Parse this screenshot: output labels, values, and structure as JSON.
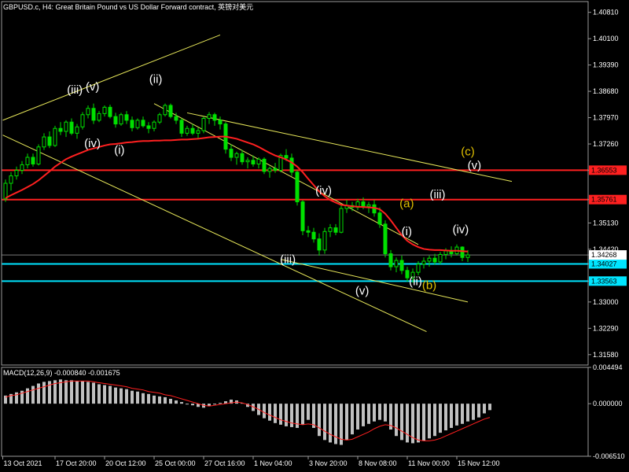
{
  "chart_data": [
    {
      "type": "candlestick",
      "title": "GBPUSD.c, H4:  Great Britain Pound vs US Dollar Forward contract, 英镑对美元",
      "y_ticks": [
        "1.40810",
        "1.40100",
        "1.39390",
        "1.38680",
        "1.37970",
        "1.37260",
        "1.36553",
        "1.35761",
        "1.35130",
        "1.34420",
        "1.34268",
        "1.34027",
        "1.33563",
        "1.33000",
        "1.32290",
        "1.31580"
      ],
      "ylim": [
        1.313,
        1.411
      ],
      "x_ticks": [
        "13 Oct 2021",
        "17 Oct 20:00",
        "20 Oct 12:00",
        "25 Oct 00:00",
        "27 Oct 16:00",
        "1 Nov 04:00",
        "3 Nov 20:00",
        "8 Nov 08:00",
        "11 Nov 00:00",
        "15 Nov 12:00"
      ],
      "horizontal_lines": [
        {
          "value": 1.36553,
          "color": "#ff2020",
          "label": "1.36553"
        },
        {
          "value": 1.35761,
          "color": "#ff2020",
          "label": "1.35761"
        },
        {
          "value": 1.34027,
          "color": "#00e5ff",
          "label": "1.34027"
        },
        {
          "value": 1.33563,
          "color": "#00e5ff",
          "label": "1.33563"
        }
      ],
      "current_price": {
        "value": 1.34268,
        "label": "1.34268"
      },
      "candles": [
        [
          1.3578,
          1.363,
          1.357,
          1.362
        ],
        [
          1.362,
          1.365,
          1.36,
          1.364
        ],
        [
          1.364,
          1.3665,
          1.363,
          1.3655
        ],
        [
          1.3655,
          1.368,
          1.3645,
          1.367
        ],
        [
          1.367,
          1.37,
          1.366,
          1.369
        ],
        [
          1.369,
          1.37,
          1.3665,
          1.3672
        ],
        [
          1.3672,
          1.3725,
          1.3668,
          1.3718
        ],
        [
          1.3718,
          1.3755,
          1.371,
          1.3745
        ],
        [
          1.3745,
          1.376,
          1.3715,
          1.3722
        ],
        [
          1.3722,
          1.3775,
          1.3718,
          1.3768
        ],
        [
          1.3768,
          1.3785,
          1.375,
          1.376
        ],
        [
          1.376,
          1.379,
          1.3745,
          1.3785
        ],
        [
          1.3785,
          1.3795,
          1.375,
          1.3755
        ],
        [
          1.3755,
          1.378,
          1.374,
          1.3772
        ],
        [
          1.3772,
          1.3812,
          1.3765,
          1.3805
        ],
        [
          1.3805,
          1.383,
          1.3795,
          1.3822
        ],
        [
          1.3822,
          1.3835,
          1.378,
          1.379
        ],
        [
          1.379,
          1.3815,
          1.3785,
          1.3808
        ],
        [
          1.3808,
          1.383,
          1.38,
          1.3825
        ],
        [
          1.3825,
          1.3832,
          1.3795,
          1.38
        ],
        [
          1.38,
          1.381,
          1.377,
          1.378
        ],
        [
          1.378,
          1.381,
          1.3775,
          1.3805
        ],
        [
          1.3805,
          1.3815,
          1.378,
          1.379
        ],
        [
          1.379,
          1.38,
          1.376,
          1.377
        ],
        [
          1.377,
          1.3795,
          1.3765,
          1.379
        ],
        [
          1.379,
          1.38,
          1.377,
          1.3775
        ],
        [
          1.3775,
          1.3785,
          1.3755,
          1.3768
        ],
        [
          1.3768,
          1.379,
          1.376,
          1.3785
        ],
        [
          1.3785,
          1.381,
          1.378,
          1.3805
        ],
        [
          1.3805,
          1.3835,
          1.38,
          1.383
        ],
        [
          1.383,
          1.3835,
          1.3795,
          1.38
        ],
        [
          1.38,
          1.381,
          1.378,
          1.379
        ],
        [
          1.379,
          1.3795,
          1.3745,
          1.3755
        ],
        [
          1.3755,
          1.3775,
          1.3748,
          1.3768
        ],
        [
          1.3768,
          1.378,
          1.375,
          1.3755
        ],
        [
          1.3755,
          1.377,
          1.374,
          1.3762
        ],
        [
          1.3762,
          1.38,
          1.3755,
          1.3795
        ],
        [
          1.3795,
          1.3812,
          1.378,
          1.3805
        ],
        [
          1.3805,
          1.381,
          1.3775,
          1.379
        ],
        [
          1.379,
          1.38,
          1.3765,
          1.378
        ],
        [
          1.378,
          1.3785,
          1.37,
          1.3712
        ],
        [
          1.3712,
          1.3725,
          1.368,
          1.369
        ],
        [
          1.369,
          1.3705,
          1.367,
          1.37
        ],
        [
          1.37,
          1.371,
          1.367,
          1.3678
        ],
        [
          1.3678,
          1.369,
          1.366,
          1.3682
        ],
        [
          1.3682,
          1.3695,
          1.3665,
          1.3672
        ],
        [
          1.3672,
          1.369,
          1.366,
          1.3685
        ],
        [
          1.3685,
          1.369,
          1.3645,
          1.3652
        ],
        [
          1.3652,
          1.3665,
          1.3635,
          1.366
        ],
        [
          1.366,
          1.3675,
          1.3648,
          1.3655
        ],
        [
          1.3655,
          1.37,
          1.365,
          1.3695
        ],
        [
          1.3695,
          1.3712,
          1.368,
          1.3688
        ],
        [
          1.3688,
          1.37,
          1.364,
          1.365
        ],
        [
          1.365,
          1.3655,
          1.356,
          1.357
        ],
        [
          1.357,
          1.3575,
          1.348,
          1.3492
        ],
        [
          1.3492,
          1.3505,
          1.3475,
          1.3488
        ],
        [
          1.3488,
          1.35,
          1.346,
          1.347
        ],
        [
          1.347,
          1.3485,
          1.3425,
          1.344
        ],
        [
          1.344,
          1.35,
          1.343,
          1.349
        ],
        [
          1.349,
          1.351,
          1.3475,
          1.35
        ],
        [
          1.35,
          1.351,
          1.348,
          1.3488
        ],
        [
          1.3488,
          1.356,
          1.3485,
          1.3552
        ],
        [
          1.3552,
          1.3575,
          1.354,
          1.356
        ],
        [
          1.356,
          1.357,
          1.3545,
          1.3555
        ],
        [
          1.3555,
          1.3578,
          1.3548,
          1.357
        ],
        [
          1.357,
          1.3582,
          1.355,
          1.3558
        ],
        [
          1.3558,
          1.357,
          1.354,
          1.3562
        ],
        [
          1.3562,
          1.3575,
          1.353,
          1.354
        ],
        [
          1.354,
          1.3555,
          1.35,
          1.351
        ],
        [
          1.351,
          1.352,
          1.342,
          1.343
        ],
        [
          1.343,
          1.344,
          1.3385,
          1.3395
        ],
        [
          1.3395,
          1.342,
          1.338,
          1.3412
        ],
        [
          1.3412,
          1.3425,
          1.3375,
          1.3385
        ],
        [
          1.3385,
          1.3395,
          1.3355,
          1.3365
        ],
        [
          1.3365,
          1.339,
          1.3352,
          1.338
        ],
        [
          1.338,
          1.341,
          1.3372,
          1.3402
        ],
        [
          1.3402,
          1.342,
          1.339,
          1.341
        ],
        [
          1.341,
          1.3425,
          1.3395,
          1.3418
        ],
        [
          1.3418,
          1.343,
          1.34,
          1.3408
        ],
        [
          1.3408,
          1.3435,
          1.3402,
          1.3428
        ],
        [
          1.3428,
          1.3445,
          1.3415,
          1.3438
        ],
        [
          1.3438,
          1.345,
          1.342,
          1.343
        ],
        [
          1.343,
          1.3455,
          1.3425,
          1.3448
        ],
        [
          1.3448,
          1.345,
          1.341,
          1.342
        ],
        [
          1.342,
          1.344,
          1.3408,
          1.3427
        ]
      ],
      "ma_color": "#ff2020",
      "ma_values": [
        1.358,
        1.3588,
        1.3595,
        1.3602,
        1.361,
        1.3618,
        1.3628,
        1.364,
        1.3652,
        1.3665,
        1.3675,
        1.3685,
        1.3692,
        1.3698,
        1.3704,
        1.371,
        1.3714,
        1.3718,
        1.3722,
        1.3725,
        1.3726,
        1.3728,
        1.373,
        1.3731,
        1.3733,
        1.3734,
        1.3734,
        1.3735,
        1.3735,
        1.3736,
        1.3736,
        1.3737,
        1.3738,
        1.3738,
        1.3739,
        1.374,
        1.3742,
        1.3744,
        1.3745,
        1.3746,
        1.3746,
        1.3743,
        1.374,
        1.3735,
        1.373,
        1.3725,
        1.3718,
        1.371,
        1.3702,
        1.3695,
        1.369,
        1.3684,
        1.3676,
        1.3665,
        1.365,
        1.3632,
        1.3615,
        1.3598,
        1.3585,
        1.3575,
        1.3568,
        1.3562,
        1.356,
        1.3558,
        1.3557,
        1.3556,
        1.3555,
        1.3554,
        1.355,
        1.3538,
        1.352,
        1.35,
        1.348,
        1.3465,
        1.3455,
        1.3448,
        1.3443,
        1.3441,
        1.344,
        1.344,
        1.3439,
        1.3438,
        1.3438,
        1.3437,
        1.3436
      ],
      "trendlines": [
        {
          "from": {
            "c": -0.5,
            "p": 1.379
          },
          "to": {
            "c": 39.0,
            "p": 1.402
          }
        },
        {
          "from": {
            "c": -0.5,
            "p": 1.375
          },
          "to": {
            "c": 76.5,
            "p": 1.322
          }
        },
        {
          "from": {
            "c": 27.0,
            "p": 1.3835
          },
          "to": {
            "c": 75.0,
            "p": 1.3455
          }
        },
        {
          "from": {
            "c": 33.0,
            "p": 1.381
          },
          "to": {
            "c": 92.0,
            "p": 1.3625
          }
        },
        {
          "from": {
            "c": 50.0,
            "p": 1.3415
          },
          "to": {
            "c": 84.0,
            "p": 1.33
          }
        }
      ],
      "annotations": [
        {
          "text": "(iii)",
          "c": 12.6,
          "p": 1.3862,
          "color": "#ffffff"
        },
        {
          "text": "(v)",
          "c": 15.8,
          "p": 1.387,
          "color": "#ffffff"
        },
        {
          "text": "(ii)",
          "c": 27.3,
          "p": 1.389,
          "color": "#ffffff"
        },
        {
          "text": "(iv)",
          "c": 15.8,
          "p": 1.3718,
          "color": "#ffffff"
        },
        {
          "text": "(i)",
          "c": 20.7,
          "p": 1.37,
          "color": "#ffffff"
        },
        {
          "text": "(iii)",
          "c": 51.3,
          "p": 1.3405,
          "color": "#ffffff"
        },
        {
          "text": "(iv)",
          "c": 57.8,
          "p": 1.359,
          "color": "#ffffff"
        },
        {
          "text": "(v)",
          "c": 64.8,
          "p": 1.332,
          "color": "#ffffff"
        },
        {
          "text": "(a)",
          "c": 72.9,
          "p": 1.3555,
          "color": "#e0c000"
        },
        {
          "text": "(i)",
          "c": 72.9,
          "p": 1.348,
          "color": "#ffffff"
        },
        {
          "text": "(iii)",
          "c": 78.5,
          "p": 1.358,
          "color": "#ffffff"
        },
        {
          "text": "(ii)",
          "c": 74.5,
          "p": 1.3345,
          "color": "#ffffff"
        },
        {
          "text": "(b)",
          "c": 77.0,
          "p": 1.3335,
          "color": "#e0c000"
        },
        {
          "text": "(iv)",
          "c": 82.7,
          "p": 1.3485,
          "color": "#ffffff"
        },
        {
          "text": "(c)",
          "c": 84.0,
          "p": 1.3695,
          "color": "#e0c000"
        },
        {
          "text": "(v)",
          "c": 85.2,
          "p": 1.3658,
          "color": "#ffffff"
        }
      ]
    },
    {
      "type": "bar",
      "title": "MACD(12,26,9) -0.000840 -0.001675",
      "y_ticks": [
        "0.004494",
        "0.000000",
        "-0.006510"
      ],
      "ylim": [
        -0.00651,
        0.004494
      ],
      "histogram": [
        0.001,
        0.0012,
        0.0014,
        0.0016,
        0.0019,
        0.0022,
        0.0025,
        0.0027,
        0.0028,
        0.0029,
        0.003,
        0.0029,
        0.0029,
        0.0028,
        0.0028,
        0.0027,
        0.0026,
        0.0024,
        0.0023,
        0.0022,
        0.002,
        0.0019,
        0.0018,
        0.0016,
        0.0015,
        0.0013,
        0.0012,
        0.001,
        0.0009,
        0.0008,
        0.0006,
        0.0004,
        0.0002,
        0.0,
        -0.0002,
        -0.0004,
        -0.0005,
        -0.0003,
        -0.0001,
        0.0001,
        0.0003,
        0.0005,
        0.0004,
        0.0001,
        -0.0004,
        -0.0009,
        -0.0014,
        -0.0018,
        -0.0021,
        -0.0024,
        -0.0026,
        -0.0028,
        -0.0029,
        -0.003,
        -0.0026,
        -0.002,
        -0.003,
        -0.004,
        -0.0045,
        -0.0048,
        -0.005,
        -0.0051,
        -0.0045,
        -0.0038,
        -0.0032,
        -0.0028,
        -0.0025,
        -0.0022,
        -0.002,
        -0.0022,
        -0.0032,
        -0.004,
        -0.0045,
        -0.0048,
        -0.0049,
        -0.0048,
        -0.0046,
        -0.0043,
        -0.004,
        -0.0036,
        -0.0033,
        -0.003,
        -0.0027,
        -0.0025,
        -0.0022,
        -0.002,
        -0.0017,
        -0.0012,
        -0.0008
      ],
      "signal_color": "#ff2020",
      "signal": [
        0.0008,
        0.001,
        0.0011,
        0.0013,
        0.0015,
        0.0017,
        0.0019,
        0.0021,
        0.0023,
        0.0025,
        0.0026,
        0.0027,
        0.0028,
        0.0028,
        0.0028,
        0.0028,
        0.0027,
        0.0026,
        0.0025,
        0.0024,
        0.0023,
        0.0022,
        0.0021,
        0.0019,
        0.0018,
        0.0017,
        0.0015,
        0.0014,
        0.0013,
        0.0011,
        0.001,
        0.0008,
        0.0006,
        0.0004,
        0.0002,
        0.0,
        -0.0002,
        -0.0003,
        -0.0002,
        -0.0001,
        0.0,
        0.0001,
        0.0002,
        0.0001,
        -0.0001,
        -0.0004,
        -0.0007,
        -0.0011,
        -0.0014,
        -0.0017,
        -0.002,
        -0.0022,
        -0.0024,
        -0.0025,
        -0.0026,
        -0.0025,
        -0.0026,
        -0.003,
        -0.0034,
        -0.0038,
        -0.0041,
        -0.0044,
        -0.0045,
        -0.0044,
        -0.0041,
        -0.0038,
        -0.0035,
        -0.0031,
        -0.0028,
        -0.0026,
        -0.0027,
        -0.003,
        -0.0034,
        -0.0038,
        -0.0042,
        -0.0045,
        -0.0046,
        -0.0046,
        -0.0045,
        -0.0043,
        -0.004,
        -0.0037,
        -0.0034,
        -0.0031,
        -0.0028,
        -0.0025,
        -0.0022,
        -0.0019,
        -0.0017
      ]
    }
  ]
}
